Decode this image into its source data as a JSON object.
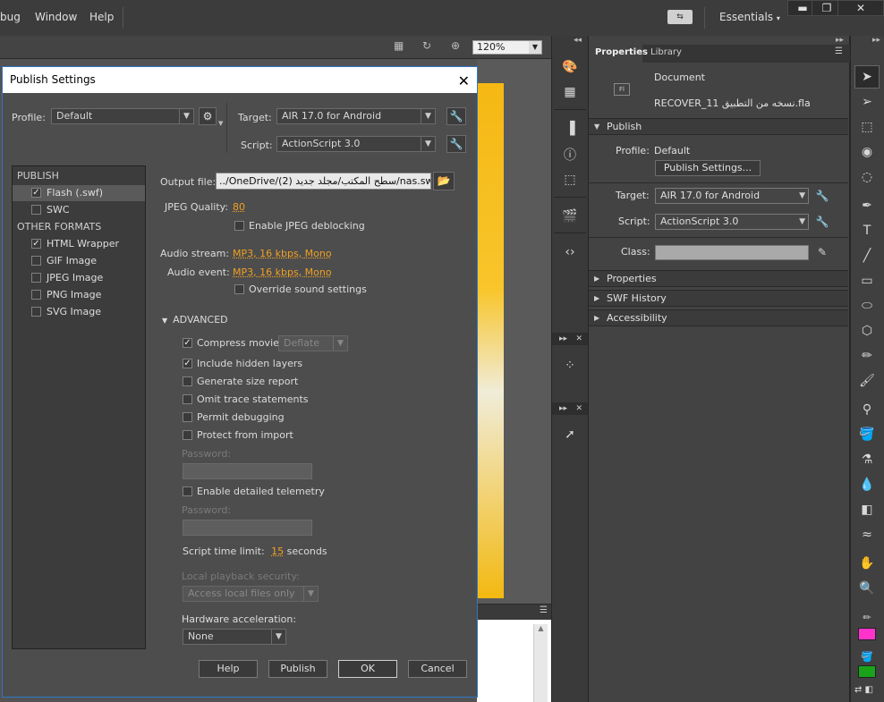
{
  "menubar": {
    "items": [
      "bug",
      "Window",
      "Help"
    ],
    "workspace": "Essentials",
    "window_controls": {
      "minimize": "▬",
      "restore": "❐",
      "close": "✕"
    }
  },
  "stage": {
    "zoom": "120%"
  },
  "middle_tools": [
    "palette-icon",
    "grid-icon",
    "align-icon",
    "info-icon",
    "transform-icon",
    "motion-presets-icon",
    "code-snippets-icon",
    "components-icon",
    "export-icon"
  ],
  "properties_panel": {
    "tabs": [
      "Properties",
      "Library"
    ],
    "doc_type": "Document",
    "doc_icon": "Fl",
    "filename": "RECOVER_11 نسخه من التطبيق.fla",
    "sections": {
      "publish": "Publish",
      "properties": "Properties",
      "swf_history": "SWF History",
      "accessibility": "Accessibility"
    },
    "profile_label": "Profile:",
    "profile_value": "Default",
    "publish_settings_button": "Publish Settings...",
    "target_label": "Target:",
    "target_value": "AIR 17.0 for Android",
    "script_label": "Script:",
    "script_value": "ActionScript 3.0",
    "class_label": "Class:",
    "class_value": ""
  },
  "toolbar": [
    "selection-tool-icon",
    "subselection-tool-icon",
    "free-transform-tool-icon",
    "3d-rotation-tool-icon",
    "lasso-tool-icon",
    "pen-tool-icon",
    "text-tool-icon",
    "line-tool-icon",
    "rectangle-tool-icon",
    "oval-tool-icon",
    "polystar-tool-icon",
    "pencil-tool-icon",
    "brush-tool-icon",
    "bone-tool-icon",
    "paint-bucket-tool-icon",
    "ink-bottle-tool-icon",
    "eyedropper-tool-icon",
    "eraser-tool-icon",
    "width-tool-icon",
    "hand-tool-icon",
    "zoom-tool-icon"
  ],
  "colors": {
    "stroke": "#ff33cc",
    "fill": "#1aa31a"
  },
  "dialog": {
    "title": "Publish Settings",
    "close": "✕",
    "profile_label": "Profile:",
    "profile_value": "Default",
    "target_label": "Target:",
    "target_value": "AIR 17.0 for Android",
    "script_label": "Script:",
    "script_value": "ActionScript 3.0",
    "formats": {
      "publish_group": "PUBLISH",
      "other_group": "OTHER FORMATS",
      "publish_items": [
        {
          "label": "Flash (.swf)",
          "checked": true
        },
        {
          "label": "SWC",
          "checked": false
        }
      ],
      "other_items": [
        {
          "label": "HTML Wrapper",
          "checked": true
        },
        {
          "label": "GIF Image",
          "checked": false
        },
        {
          "label": "JPEG Image",
          "checked": false
        },
        {
          "label": "PNG Image",
          "checked": false
        },
        {
          "label": "SVG Image",
          "checked": false
        }
      ]
    },
    "output_file_label": "Output file:",
    "output_file_value": "../OneDrive/سطح المكتب/مجلد جديد (2)/nas.swf",
    "jpeg_quality_label": "JPEG Quality:",
    "jpeg_quality_value": "80",
    "enable_jpeg_deblocking": "Enable JPEG deblocking",
    "audio_stream_label": "Audio stream:",
    "audio_stream_value": "MP3, 16 kbps, Mono",
    "audio_event_label": "Audio event:",
    "audio_event_value": "MP3, 16 kbps, Mono",
    "override_sound": "Override sound settings",
    "advanced_label": "ADVANCED",
    "compress_movie": "Compress movie",
    "compress_method": "Deflate",
    "include_hidden_layers": "Include hidden layers",
    "generate_size_report": "Generate size report",
    "omit_trace": "Omit trace statements",
    "permit_debugging": "Permit debugging",
    "protect_import": "Protect from import",
    "password_label": "Password:",
    "enable_telemetry": "Enable detailed telemetry",
    "password2_label": "Password:",
    "script_time_limit_label": "Script time limit:",
    "script_time_limit_value": "15",
    "script_time_limit_unit": "seconds",
    "local_playback_label": "Local playback security:",
    "local_playback_value": "Access local files only",
    "hardware_accel_label": "Hardware acceleration:",
    "hardware_accel_value": "None",
    "buttons": {
      "help": "Help",
      "publish": "Publish",
      "ok": "OK",
      "cancel": "Cancel"
    }
  }
}
